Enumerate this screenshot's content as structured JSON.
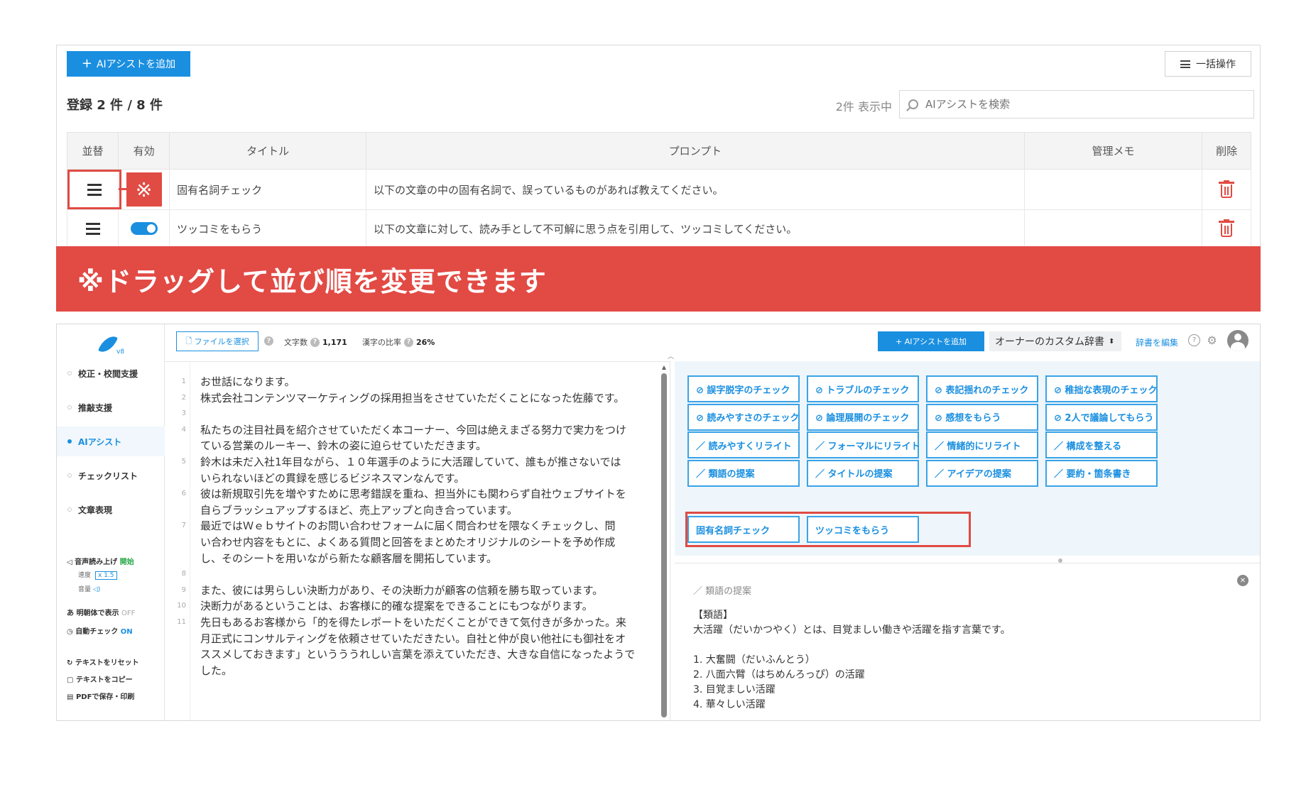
{
  "top": {
    "add_button": "AIアシストを追加",
    "bulk_button": "一括操作",
    "count_label": "登録 2 件 / 8 件",
    "shown_label": "2件 表示中",
    "search_placeholder": "AIアシストを検索",
    "columns": [
      "並替",
      "有効",
      "タイトル",
      "プロンプト",
      "管理メモ",
      "削除"
    ],
    "rows": [
      {
        "title": "固有名詞チェック",
        "prompt": "以下の文章の中の固有名詞で、誤っているものがあれば教えてください。",
        "memo": "",
        "status_mark": "※"
      },
      {
        "title": "ツッコミをもらう",
        "prompt": "以下の文章に対して、読み手として不可解に思う点を引用して、ツッコミしてください。",
        "memo": "",
        "enabled": true
      }
    ]
  },
  "banner": {
    "text": "※ドラッグして並び順を変更できます"
  },
  "app": {
    "logo_version": "v8",
    "nav": [
      {
        "label": "校正・校閲支援",
        "active": false
      },
      {
        "label": "推敲支援",
        "active": false
      },
      {
        "label": "AIアシスト",
        "active": true
      },
      {
        "label": "チェックリスト",
        "active": false
      },
      {
        "label": "文章表現",
        "active": false
      }
    ],
    "tools": {
      "tts": "音声読み上げ",
      "tts_start": "開始",
      "speed_label": "速度",
      "speed_value": "x 1.5",
      "volume_label": "音量",
      "mincho": "明朝体で表示",
      "mincho_state": "OFF",
      "autocheck": "自動チェック",
      "autocheck_state": "ON",
      "reset": "テキストをリセット",
      "copy": "テキストをコピー",
      "pdf": "PDFで保存・印刷"
    },
    "toolbar": {
      "file_button": "ファイルを選択",
      "char_count_label": "文字数",
      "char_count": "1,171",
      "kanji_label": "漢字の比率",
      "kanji_ratio": "26%",
      "ai_add_button": "AIアシストを追加",
      "dictionary": "オーナーのカスタム辞書",
      "edit_dictionary": "辞書を編集"
    },
    "editor_lines": [
      {
        "no": "1",
        "text": "お世話になります。"
      },
      {
        "no": "2",
        "text": "株式会社コンテンツマーケティングの採用担当をさせていただくことになった佐藤です。"
      },
      {
        "no": "3",
        "text": ""
      },
      {
        "no": "4",
        "text": "私たちの注目社員を紹介させていただく本コーナー、今回は絶えまざる努力で実力をつけ"
      },
      {
        "no": "",
        "text": "ている営業のルーキー、鈴木の姿に迫らせていただきます。"
      },
      {
        "no": "5",
        "text": "鈴木は未だ入社1年目ながら、１０年選手のように大活躍していて、誰もが推さないでは"
      },
      {
        "no": "",
        "text": "いられないほどの貫録を感じるビジネスマンなんです。"
      },
      {
        "no": "6",
        "text": "彼は新規取引先を増やすために思考錯誤を重ね、担当外にも関わらず自社ウェブサイトを"
      },
      {
        "no": "",
        "text": "自らブラッシュアップするほど、売上アップと向き合っています。"
      },
      {
        "no": "7",
        "text": "最近ではＷｅｂサイトのお問い合わせフォームに届く問合わせを隈なくチェックし、問"
      },
      {
        "no": "",
        "text": "い合わせ内容をもとに、よくある質問と回答をまとめたオリジナルのシートを予め作成"
      },
      {
        "no": "",
        "text": "し、そのシートを用いながら新たな顧客層を開拓しています。"
      },
      {
        "no": "8",
        "text": ""
      },
      {
        "no": "9",
        "text": "また、彼には男らしい決断力があり、その決断力が顧客の信頼を勝ち取っています。"
      },
      {
        "no": "10",
        "text": "決断力があるということは、お客様に的確な提案をできることにもつながります。"
      },
      {
        "no": "11",
        "text": "先日もあるお客様から「的を得たレポートをいただくことができて気付きが多かった。来"
      },
      {
        "no": "",
        "text": "月正式にコンサルティングを依頼させていただきたい。自社と仲が良い他社にも御社をオ"
      },
      {
        "no": "",
        "text": "ススメしておきます」というううれしい言葉を添えていただき、大きな自信になったようで"
      },
      {
        "no": "",
        "text": "した。"
      }
    ],
    "assist_chips": [
      "⊘ 誤字脱字のチェック",
      "⊘ トラブルのチェック",
      "⊘ 表記揺れのチェック",
      "⊘ 稚拙な表現のチェック",
      "⊘ 読みやすさのチェック",
      "⊘ 論理展開のチェック",
      "⊘ 感想をもらう",
      "⊘ 2人で議論してもらう",
      "／ 読みやすくリライト",
      "／ フォーマルにリライト",
      "／ 情緒的にリライト",
      "／ 構成を整える",
      "／ 類語の提案",
      "／ タイトルの提案",
      "／ アイデアの提案",
      "／ 要約・箇条書き"
    ],
    "custom_chips": [
      "固有名詞チェック",
      "ツッコミをもらう"
    ],
    "result": {
      "heading": "類語の提案",
      "lines": [
        "【類語】",
        "大活躍（だいかつやく）とは、目覚ましい働きや活躍を指す言葉です。",
        "",
        "1. 大奮闘（だいふんとう）",
        "2. 八面六臂（はちめんろっぴ）の活躍",
        "3. 目覚ましい活躍",
        "4. 華々しい活躍"
      ]
    }
  }
}
